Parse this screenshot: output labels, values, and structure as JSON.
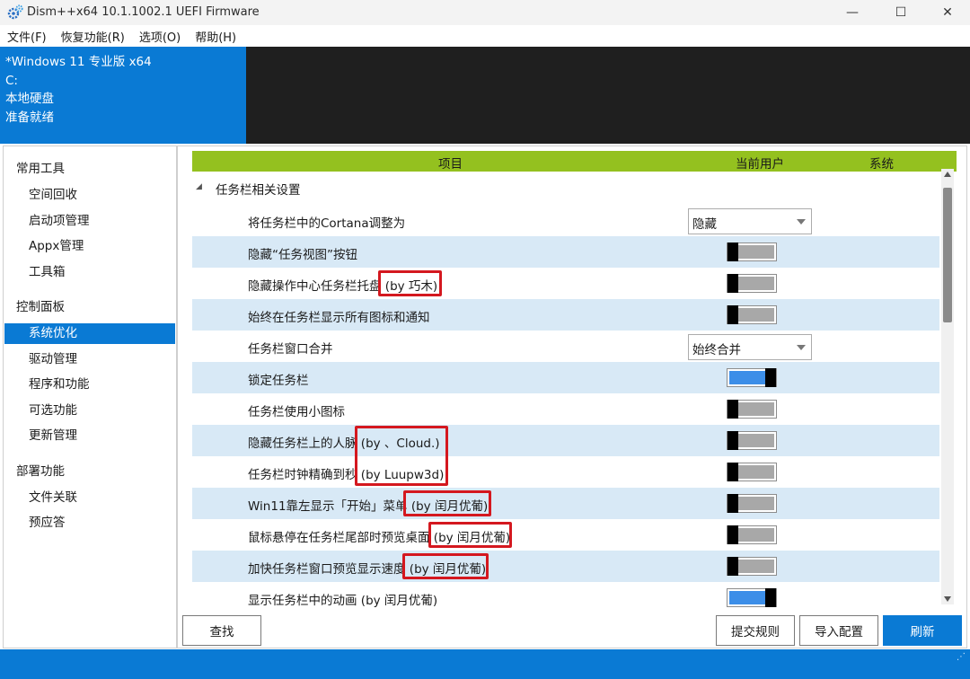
{
  "window": {
    "title": "Dism++x64 10.1.1002.1 UEFI Firmware",
    "minimize": "—",
    "maximize": "☐",
    "close": "✕"
  },
  "menu": [
    "文件(F)",
    "恢复功能(R)",
    "选项(O)",
    "帮助(H)"
  ],
  "header": {
    "lines": [
      "*Windows 11 专业版 x64",
      "C:",
      "本地硬盘",
      "准备就绪"
    ]
  },
  "sidebar": {
    "categories": [
      {
        "label": "常用工具",
        "items": [
          "空间回收",
          "启动项管理",
          "Appx管理",
          "工具箱"
        ]
      },
      {
        "label": "控制面板",
        "items": [
          "系统优化",
          "驱动管理",
          "程序和功能",
          "可选功能",
          "更新管理"
        ]
      },
      {
        "label": "部署功能",
        "items": [
          "文件关联",
          "预应答"
        ]
      }
    ],
    "active": "系统优化"
  },
  "table": {
    "columns": {
      "item": "项目",
      "current_user": "当前用户",
      "system": "系统"
    },
    "group": "任务栏相关设置",
    "rows": [
      {
        "label": "将任务栏中的Cortana调整为",
        "control": "select",
        "value": "隐藏"
      },
      {
        "label": "隐藏“任务视图”按钮",
        "control": "toggle",
        "on": false
      },
      {
        "label": "隐藏操作中心任务栏托盘",
        "note": "(by 巧木)",
        "control": "toggle",
        "on": false
      },
      {
        "label": "始终在任务栏显示所有图标和通知",
        "control": "toggle",
        "on": false
      },
      {
        "label": "任务栏窗口合并",
        "control": "select",
        "value": "始终合并"
      },
      {
        "label": "锁定任务栏",
        "control": "toggle",
        "on": true
      },
      {
        "label": "任务栏使用小图标",
        "control": "toggle",
        "on": false
      },
      {
        "label": "隐藏任务栏上的人脉",
        "note": "(by 、Cloud.)",
        "control": "toggle",
        "on": false
      },
      {
        "label": "任务栏时钟精确到秒",
        "note": "(by Luupw3d)",
        "control": "toggle",
        "on": false
      },
      {
        "label": "Win11靠左显示「开始」菜单",
        "note": "(by 闰月优葡)",
        "control": "toggle",
        "on": false
      },
      {
        "label": "鼠标悬停在任务栏尾部时预览桌面",
        "note": "(by 闰月优葡)",
        "control": "toggle",
        "on": false
      },
      {
        "label": "加快任务栏窗口预览显示速度",
        "note": "(by 闰月优葡)",
        "control": "toggle",
        "on": false
      },
      {
        "label": "显示任务栏中的动画",
        "note": "(by 闰月优葡)",
        "control": "toggle",
        "on": true
      }
    ]
  },
  "buttons": {
    "find": "查找",
    "submit_rule": "提交规则",
    "import_config": "导入配置",
    "refresh": "刷新"
  },
  "colors": {
    "accent": "#0a7ad4",
    "header_green": "#94c11f",
    "highlight_red": "#d4181f",
    "row_alt": "#d8e9f6"
  }
}
